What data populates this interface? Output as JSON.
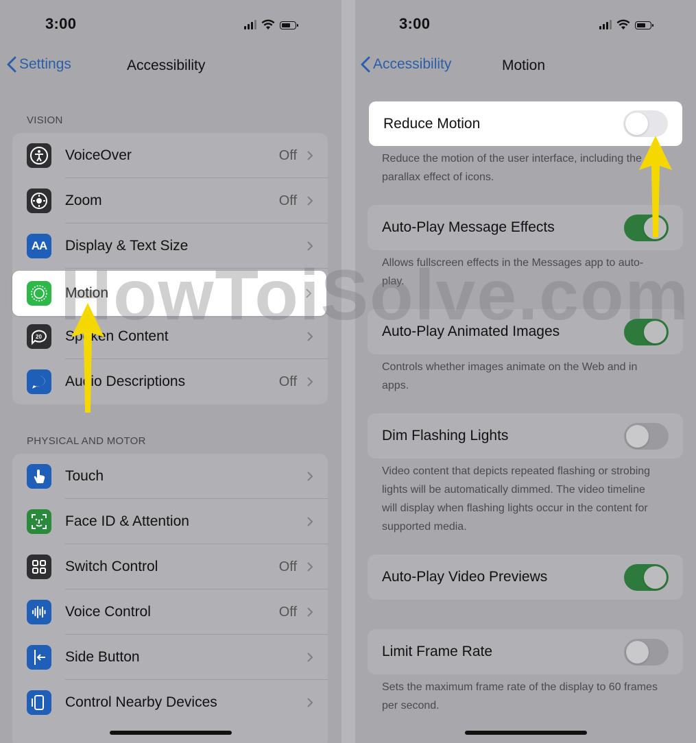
{
  "left": {
    "status_time": "3:00",
    "back_label": "Settings",
    "title": "Accessibility",
    "sections": [
      {
        "header": "VISION",
        "items": [
          {
            "label": "VoiceOver",
            "value": "Off",
            "icon": "voiceover-icon",
            "color": "#1f5fb8"
          },
          {
            "label": "Zoom",
            "value": "Off",
            "icon": "zoom-icon",
            "color": "#1f1f21"
          },
          {
            "label": "Display & Text Size",
            "value": "",
            "icon": "display-text-icon",
            "color": "#1f5fb8"
          },
          {
            "label": "Motion",
            "value": "",
            "icon": "motion-icon",
            "color": "#2fb84a"
          },
          {
            "label": "Spoken Content",
            "value": "",
            "icon": "spoken-content-icon",
            "color": "#1f1f21"
          },
          {
            "label": "Audio Descriptions",
            "value": "Off",
            "icon": "audio-descriptions-icon",
            "color": "#1f5fb8"
          }
        ]
      },
      {
        "header": "PHYSICAL AND MOTOR",
        "items": [
          {
            "label": "Touch",
            "value": "",
            "icon": "touch-icon",
            "color": "#1f5fb8"
          },
          {
            "label": "Face ID & Attention",
            "value": "",
            "icon": "face-id-icon",
            "color": "#2a8a3c"
          },
          {
            "label": "Switch Control",
            "value": "Off",
            "icon": "switch-control-icon",
            "color": "#1f1f21"
          },
          {
            "label": "Voice Control",
            "value": "Off",
            "icon": "voice-control-icon",
            "color": "#1f5fb8"
          },
          {
            "label": "Side Button",
            "value": "",
            "icon": "side-button-icon",
            "color": "#1f5fb8"
          },
          {
            "label": "Control Nearby Devices",
            "value": "",
            "icon": "nearby-devices-icon",
            "color": "#1f5fb8"
          }
        ]
      }
    ]
  },
  "right": {
    "status_time": "3:00",
    "back_label": "Accessibility",
    "title": "Motion",
    "settings": [
      {
        "label": "Reduce Motion",
        "on": false,
        "footer": "Reduce the motion of the user interface, including the parallax effect of icons."
      },
      {
        "label": "Auto-Play Message Effects",
        "on": true,
        "footer": "Allows fullscreen effects in the Messages app to auto-play."
      },
      {
        "label": "Auto-Play Animated Images",
        "on": true,
        "footer": "Controls whether images animate on the Web and in apps."
      },
      {
        "label": "Dim Flashing Lights",
        "on": false,
        "footer": "Video content that depicts repeated flashing or strobing lights will be automatically dimmed. The video timeline will display when flashing lights occur in the content for supported media."
      },
      {
        "label": "Auto-Play Video Previews",
        "on": true,
        "footer": ""
      },
      {
        "label": "Limit Frame Rate",
        "on": false,
        "footer": "Sets the maximum frame rate of the display to 60 frames per second."
      }
    ]
  },
  "watermark": "HowToiSolve.com",
  "colors": {
    "accent": "#2b5ea8",
    "toggle_on": "#2e7a3c",
    "arrow": "#f5d800"
  }
}
